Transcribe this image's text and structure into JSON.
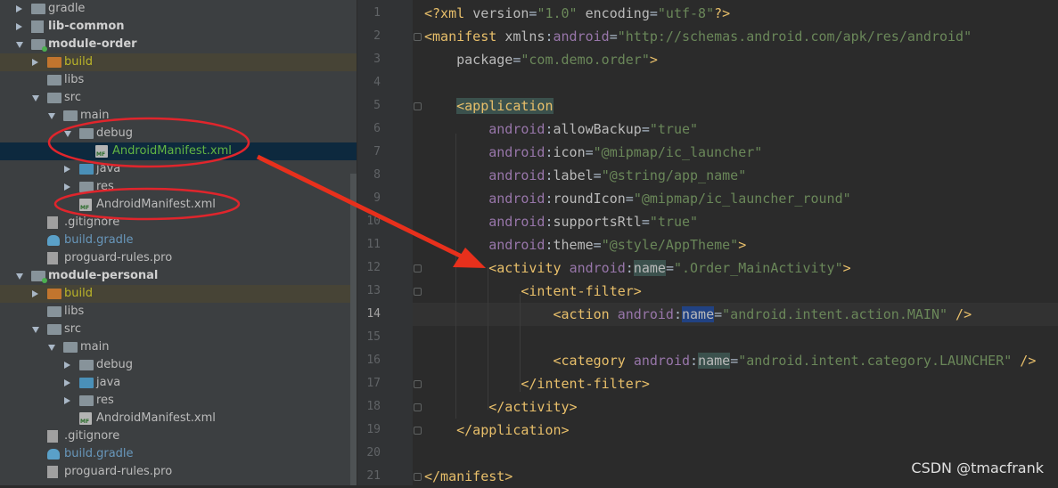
{
  "project_tree": {
    "items": [
      {
        "label": "gradle",
        "icon": "folder-icon",
        "arrow": "right",
        "indent": 0
      },
      {
        "label": "lib-common",
        "icon": "library-module-icon",
        "arrow": "right",
        "indent": 0,
        "bold": true
      },
      {
        "label": "module-order",
        "icon": "module-icon",
        "arrow": "down",
        "indent": 0,
        "bold": true
      },
      {
        "label": "build",
        "icon": "build-folder-icon",
        "arrow": "right",
        "indent": 1,
        "color": "yellow",
        "highlight": true
      },
      {
        "label": "libs",
        "icon": "folder-icon",
        "arrow": "",
        "indent": 1
      },
      {
        "label": "src",
        "icon": "folder-icon",
        "arrow": "down",
        "indent": 1
      },
      {
        "label": "main",
        "icon": "folder-icon",
        "arrow": "down",
        "indent": 2
      },
      {
        "label": "debug",
        "icon": "folder-icon",
        "arrow": "down",
        "indent": 3
      },
      {
        "label": "AndroidManifest.xml",
        "icon": "manifest-file-icon",
        "arrow": "",
        "indent": 4,
        "color": "green",
        "selected": true
      },
      {
        "label": "java",
        "icon": "java-folder-icon",
        "arrow": "right",
        "indent": 3
      },
      {
        "label": "res",
        "icon": "res-folder-icon",
        "arrow": "right",
        "indent": 3
      },
      {
        "label": "AndroidManifest.xml",
        "icon": "manifest-file-icon",
        "arrow": "",
        "indent": 3
      },
      {
        "label": ".gitignore",
        "icon": "gitignore-file-icon",
        "arrow": "",
        "indent": 1
      },
      {
        "label": "build.gradle",
        "icon": "gradle-file-icon",
        "arrow": "",
        "indent": 1,
        "color": "blue"
      },
      {
        "label": "proguard-rules.pro",
        "icon": "text-file-icon",
        "arrow": "",
        "indent": 1
      },
      {
        "label": "module-personal",
        "icon": "module-icon",
        "arrow": "down",
        "indent": 0,
        "bold": true
      },
      {
        "label": "build",
        "icon": "build-folder-icon",
        "arrow": "right",
        "indent": 1,
        "color": "yellow",
        "highlight": true
      },
      {
        "label": "libs",
        "icon": "folder-icon",
        "arrow": "",
        "indent": 1
      },
      {
        "label": "src",
        "icon": "folder-icon",
        "arrow": "down",
        "indent": 1
      },
      {
        "label": "main",
        "icon": "folder-icon",
        "arrow": "down",
        "indent": 2
      },
      {
        "label": "debug",
        "icon": "folder-icon",
        "arrow": "right",
        "indent": 3
      },
      {
        "label": "java",
        "icon": "java-folder-icon",
        "arrow": "right",
        "indent": 3
      },
      {
        "label": "res",
        "icon": "res-folder-icon",
        "arrow": "right",
        "indent": 3
      },
      {
        "label": "AndroidManifest.xml",
        "icon": "manifest-file-icon",
        "arrow": "",
        "indent": 3
      },
      {
        "label": ".gitignore",
        "icon": "gitignore-file-icon",
        "arrow": "",
        "indent": 1
      },
      {
        "label": "build.gradle",
        "icon": "gradle-file-icon",
        "arrow": "",
        "indent": 1,
        "color": "blue"
      },
      {
        "label": "proguard-rules.pro",
        "icon": "text-file-icon",
        "arrow": "",
        "indent": 1
      }
    ]
  },
  "editor": {
    "current_line": 14,
    "lines": [
      {
        "n": "1",
        "fold": false,
        "tokens": [
          [
            "t",
            "<?xml "
          ],
          [
            "a",
            "version"
          ],
          [
            "p",
            "="
          ],
          [
            "v",
            "\"1.0\""
          ],
          [
            "a",
            " encoding"
          ],
          [
            "p",
            "="
          ],
          [
            "v",
            "\"utf-8\""
          ],
          [
            "t",
            "?>"
          ]
        ]
      },
      {
        "n": "2",
        "fold": true,
        "tokens": [
          [
            "t",
            "<manifest "
          ],
          [
            "a",
            "xmlns"
          ],
          [
            "p",
            ":"
          ],
          [
            "n",
            "android"
          ],
          [
            "p",
            "="
          ],
          [
            "v",
            "\"http://schemas.android.com/apk/res/android\""
          ]
        ]
      },
      {
        "n": "3",
        "fold": false,
        "tokens": [
          [
            "a",
            "    package"
          ],
          [
            "p",
            "="
          ],
          [
            "v",
            "\"com.demo.order\""
          ],
          [
            "t",
            ">"
          ]
        ]
      },
      {
        "n": "4",
        "fold": false,
        "tokens": []
      },
      {
        "n": "5",
        "fold": true,
        "tokens": [
          [
            "p",
            "    "
          ],
          [
            "th",
            "<application"
          ]
        ]
      },
      {
        "n": "6",
        "fold": false,
        "tokens": [
          [
            "n",
            "        android"
          ],
          [
            "p",
            ":"
          ],
          [
            "a",
            "allowBackup"
          ],
          [
            "p",
            "="
          ],
          [
            "v",
            "\"true\""
          ]
        ]
      },
      {
        "n": "7",
        "fold": false,
        "tokens": [
          [
            "n",
            "        android"
          ],
          [
            "p",
            ":"
          ],
          [
            "a",
            "icon"
          ],
          [
            "p",
            "="
          ],
          [
            "v",
            "\"@mipmap/ic_launcher\""
          ]
        ]
      },
      {
        "n": "8",
        "fold": false,
        "tokens": [
          [
            "n",
            "        android"
          ],
          [
            "p",
            ":"
          ],
          [
            "a",
            "label"
          ],
          [
            "p",
            "="
          ],
          [
            "v",
            "\"@string/app_name\""
          ]
        ]
      },
      {
        "n": "9",
        "fold": false,
        "tokens": [
          [
            "n",
            "        android"
          ],
          [
            "p",
            ":"
          ],
          [
            "a",
            "roundIcon"
          ],
          [
            "p",
            "="
          ],
          [
            "v",
            "\"@mipmap/ic_launcher_round\""
          ]
        ]
      },
      {
        "n": "10",
        "fold": false,
        "tokens": [
          [
            "n",
            "        android"
          ],
          [
            "p",
            ":"
          ],
          [
            "a",
            "supportsRtl"
          ],
          [
            "p",
            "="
          ],
          [
            "v",
            "\"true\""
          ]
        ]
      },
      {
        "n": "11",
        "fold": false,
        "tokens": [
          [
            "n",
            "        android"
          ],
          [
            "p",
            ":"
          ],
          [
            "a",
            "theme"
          ],
          [
            "p",
            "="
          ],
          [
            "v",
            "\"@style/AppTheme\""
          ],
          [
            "t",
            ">"
          ]
        ]
      },
      {
        "n": "12",
        "fold": true,
        "tokens": [
          [
            "t",
            "        <activity "
          ],
          [
            "n",
            "android"
          ],
          [
            "p",
            ":"
          ],
          [
            "ah",
            "name"
          ],
          [
            "p",
            "="
          ],
          [
            "v",
            "\".Order_MainActivity\""
          ],
          [
            "t",
            ">"
          ]
        ]
      },
      {
        "n": "13",
        "fold": true,
        "tokens": [
          [
            "t",
            "            <intent-filter>"
          ]
        ]
      },
      {
        "n": "14",
        "fold": false,
        "tokens": [
          [
            "t",
            "                <action "
          ],
          [
            "n",
            "android"
          ],
          [
            "p",
            ":"
          ],
          [
            "as",
            "name"
          ],
          [
            "p",
            "="
          ],
          [
            "v",
            "\"android.intent.action.MAIN\""
          ],
          [
            "t",
            " />"
          ]
        ]
      },
      {
        "n": "15",
        "fold": false,
        "tokens": []
      },
      {
        "n": "16",
        "fold": false,
        "tokens": [
          [
            "t",
            "                <category "
          ],
          [
            "n",
            "android"
          ],
          [
            "p",
            ":"
          ],
          [
            "ah",
            "name"
          ],
          [
            "p",
            "="
          ],
          [
            "v",
            "\"android.intent.category.LAUNCHER\""
          ],
          [
            "t",
            " />"
          ]
        ]
      },
      {
        "n": "17",
        "fold": true,
        "tokens": [
          [
            "t",
            "            </intent-filter>"
          ]
        ]
      },
      {
        "n": "18",
        "fold": true,
        "tokens": [
          [
            "t",
            "        </activity>"
          ]
        ]
      },
      {
        "n": "19",
        "fold": true,
        "tokens": [
          [
            "t",
            "    </application>"
          ]
        ]
      },
      {
        "n": "20",
        "fold": false,
        "tokens": []
      },
      {
        "n": "21",
        "fold": true,
        "tokens": [
          [
            "t",
            "</manifest>"
          ]
        ]
      }
    ]
  },
  "watermark": "CSDN @tmacfrank",
  "annotations": {
    "ellipse_color": "#e0252c",
    "arrow_color": "#e8301c"
  }
}
